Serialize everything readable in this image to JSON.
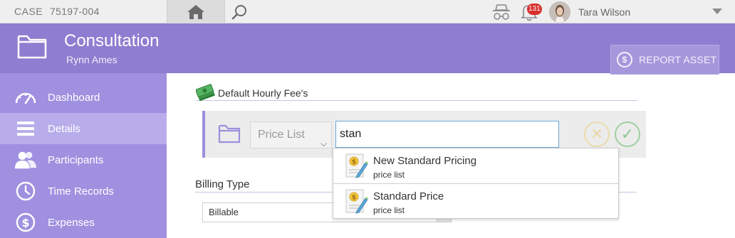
{
  "topbar": {
    "case_label": "CASE",
    "case_number": "75197-004",
    "notification_count": "131",
    "user_name": "Tara Wilson"
  },
  "header": {
    "title": "Consultation",
    "subtitle": "Rynn Ames",
    "report_button": "REPORT ASSET"
  },
  "sidebar": {
    "items": [
      {
        "label": "Dashboard",
        "icon": "speedometer-icon"
      },
      {
        "label": "Details",
        "icon": "list-icon",
        "active": true
      },
      {
        "label": "Participants",
        "icon": "people-icon"
      },
      {
        "label": "Time Records",
        "icon": "clock-icon"
      },
      {
        "label": "Expenses",
        "icon": "dollar-icon"
      }
    ]
  },
  "main": {
    "section_title": "Default Hourly Fee's",
    "price_list_select": "Price List",
    "search_value": "stan",
    "billing_type_label": "Billing Type",
    "billing_type_value": "Billable"
  },
  "autocomplete": {
    "items": [
      {
        "title": "New Standard Pricing",
        "subtitle": "price list"
      },
      {
        "title": "Standard Price",
        "subtitle": "price list"
      }
    ]
  },
  "colors": {
    "header": "#8e7dd0",
    "sidebar": "#9f90e0",
    "sidebar_active": "#b8adea",
    "accent_border": "#9d8fdc",
    "badge": "#d9302c"
  }
}
